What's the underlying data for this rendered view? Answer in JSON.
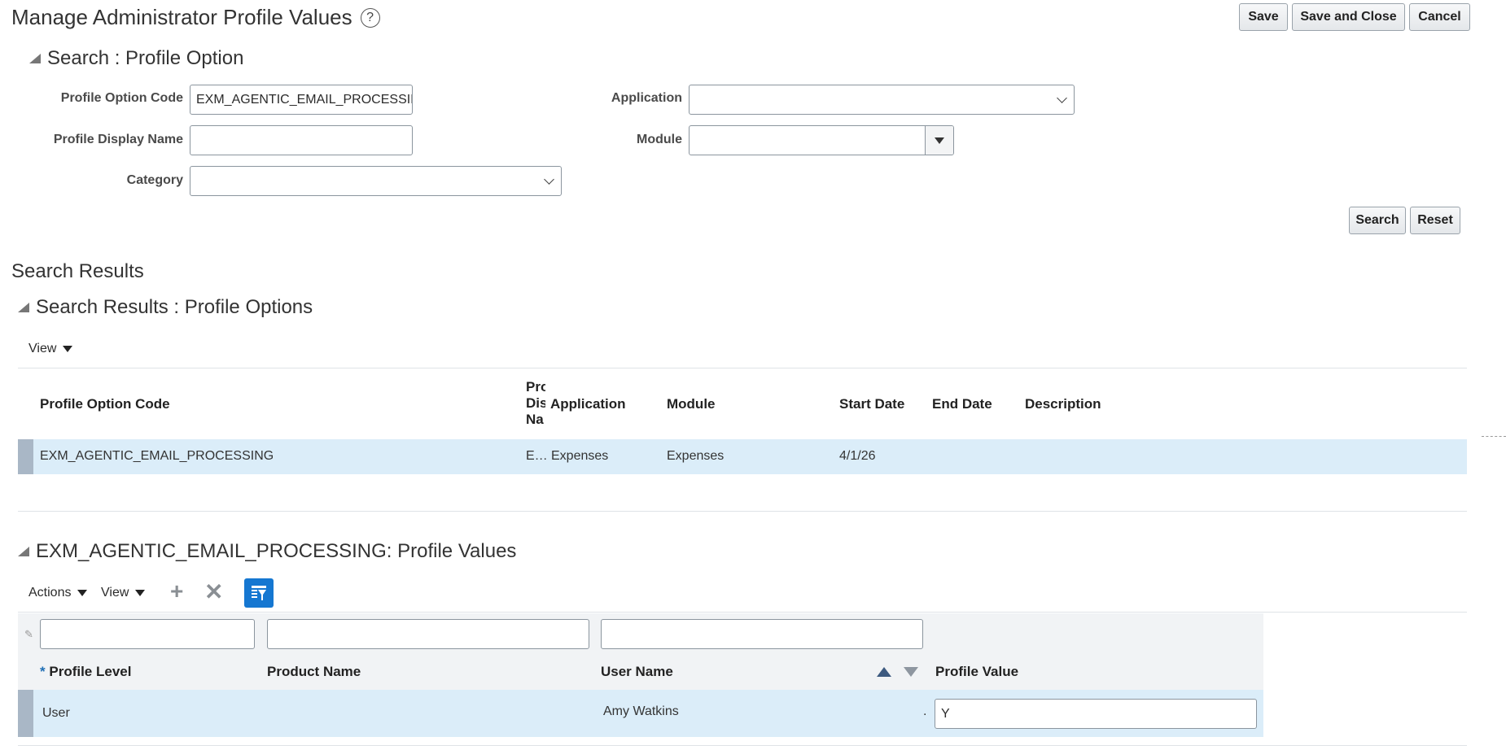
{
  "page": {
    "title": "Manage Administrator Profile Values",
    "help_icon": "?",
    "buttons": {
      "save": "Save",
      "save_close": "Save and Close",
      "cancel": "Cancel"
    }
  },
  "search": {
    "section_title": "Search : Profile Option",
    "fields": {
      "profile_option_code": {
        "label": "Profile Option Code",
        "value": "EXM_AGENTIC_EMAIL_PROCESSIN"
      },
      "profile_display_name": {
        "label": "Profile Display Name",
        "value": ""
      },
      "category": {
        "label": "Category",
        "value": ""
      },
      "application": {
        "label": "Application",
        "value": ""
      },
      "module": {
        "label": "Module",
        "value": ""
      }
    },
    "buttons": {
      "search": "Search",
      "reset": "Reset"
    }
  },
  "results": {
    "heading": "Search Results",
    "section_title": "Search Results : Profile Options",
    "view_label": "View",
    "columns": {
      "code": "Profile Option Code",
      "display_name_l1": "Pro",
      "display_name_l2": "Dis",
      "display_name_l3": "Na",
      "application": "Application",
      "module": "Module",
      "start_date": "Start Date",
      "end_date": "End Date",
      "description": "Description"
    },
    "row": {
      "code": "EXM_AGENTIC_EMAIL_PROCESSING",
      "display_name": "E…",
      "application": "Expenses",
      "module": "Expenses",
      "start_date": "4/1/26",
      "end_date": "",
      "description": ""
    }
  },
  "values": {
    "section_title": "EXM_AGENTIC_EMAIL_PROCESSING: Profile Values",
    "toolbar": {
      "actions": "Actions",
      "view": "View"
    },
    "columns": {
      "required_mark": "*",
      "profile_level": "Profile Level",
      "product_name": "Product Name",
      "user_name": "User Name",
      "profile_value": "Profile Value"
    },
    "row": {
      "profile_level": "User",
      "product_name": "",
      "user_name": "Amy Watkins",
      "dot": ".",
      "profile_value": "Y"
    }
  }
}
